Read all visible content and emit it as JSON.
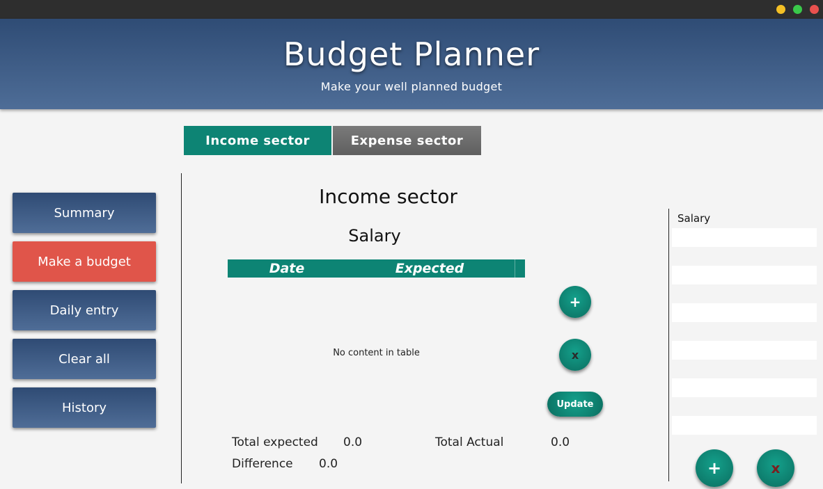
{
  "app": {
    "title": "Budget Planner",
    "subtitle": "Make your well planned budget"
  },
  "tabs": [
    {
      "label": "Income sector",
      "active": true
    },
    {
      "label": "Expense sector",
      "active": false
    }
  ],
  "nav": [
    {
      "label": "Summary"
    },
    {
      "label": "Make a budget",
      "active": true
    },
    {
      "label": "Daily entry"
    },
    {
      "label": "Clear all"
    },
    {
      "label": "History"
    }
  ],
  "main": {
    "section_title": "Income sector",
    "category_title": "Salary",
    "table": {
      "columns": [
        "Date",
        "Expected"
      ],
      "rows": [],
      "empty_message": "No content in table"
    },
    "buttons": {
      "add": "+",
      "delete": "x",
      "update": "Update"
    },
    "totals": {
      "expected_label": "Total expected",
      "expected_value": "0.0",
      "actual_label": "Total Actual",
      "actual_value": "0.0",
      "difference_label": "Difference",
      "difference_value": "0.0"
    }
  },
  "category_list": {
    "items": [
      "Salary",
      "",
      "",
      "",
      "",
      "",
      "",
      "",
      "",
      "",
      "",
      "",
      ""
    ],
    "add_button": "+",
    "delete_button": "x"
  },
  "colors": {
    "accent_teal": "#0d8474",
    "nav_blue": "#3f5d88",
    "active_red": "#e0554a"
  }
}
